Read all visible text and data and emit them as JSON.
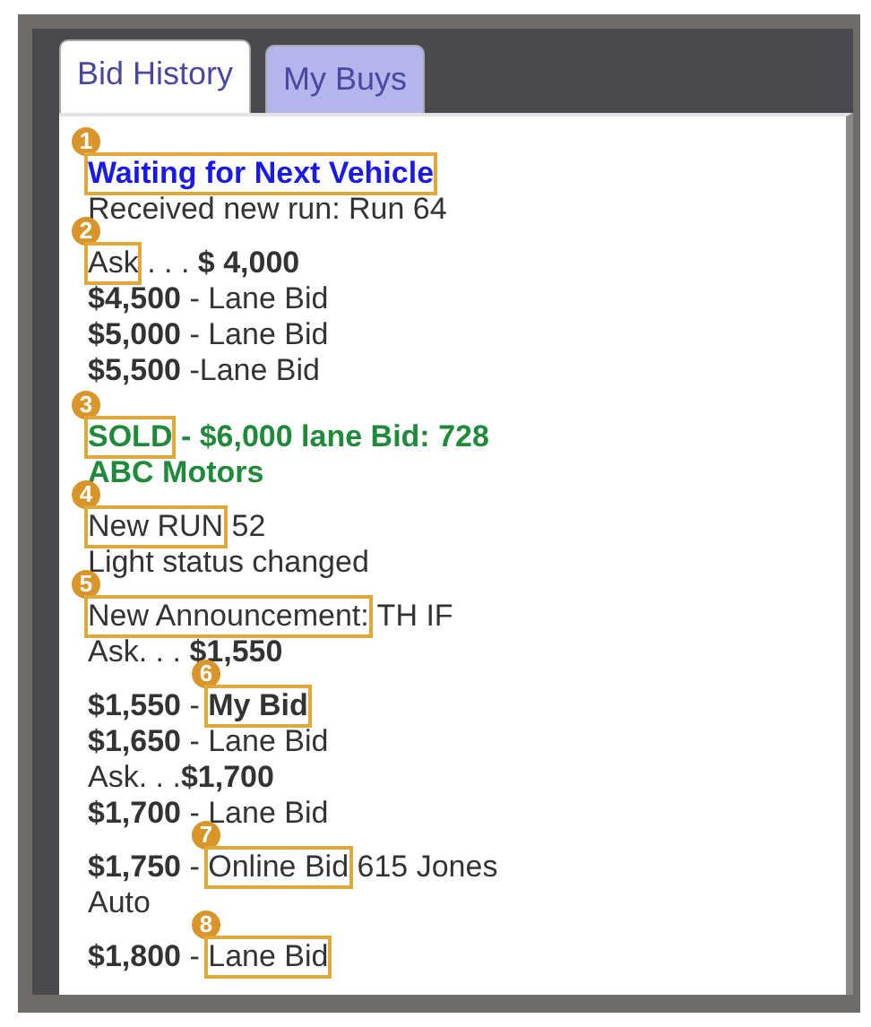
{
  "tabs": [
    {
      "label": "Bid History",
      "selected": true
    },
    {
      "label": "My Buys",
      "selected": false
    }
  ],
  "groups": [
    {
      "lines": [
        {
          "segments": [
            {
              "kind": "callout",
              "text": "1"
            },
            {
              "text": "Waiting for Next Vehicle",
              "kind": "link",
              "boxed": true
            }
          ]
        },
        {
          "segments": [
            {
              "text": "Received new run: Run 64",
              "kind": "plain"
            }
          ]
        },
        {
          "segments": [
            {
              "kind": "callout",
              "text": "2"
            },
            {
              "text": "Ask",
              "kind": "plain",
              "boxed": true
            },
            {
              "text": " . . . ",
              "kind": "plain"
            },
            {
              "text": "$ 4,000",
              "kind": "bold"
            }
          ]
        },
        {
          "segments": [
            {
              "text": "$4,500",
              "kind": "bold"
            },
            {
              "text": " - Lane Bid",
              "kind": "plain"
            }
          ]
        },
        {
          "segments": [
            {
              "text": "$5,000",
              "kind": "bold"
            },
            {
              "text": " - Lane Bid",
              "kind": "plain"
            }
          ]
        },
        {
          "segments": [
            {
              "text": "$5,500",
              "kind": "bold"
            },
            {
              "text": " -Lane Bid",
              "kind": "plain"
            }
          ]
        }
      ]
    },
    {
      "lines": [
        {
          "segments": [
            {
              "kind": "callout",
              "text": "3"
            },
            {
              "text": "SOLD",
              "kind": "sold",
              "boxed": true
            },
            {
              "text": " - $6,000 lane Bid: 728",
              "kind": "sold"
            }
          ]
        },
        {
          "segments": [
            {
              "text": "ABC Motors",
              "kind": "sold"
            }
          ]
        },
        {
          "segments": [
            {
              "kind": "callout",
              "text": "4"
            },
            {
              "text": "New RUN",
              "kind": "plain",
              "boxed": true
            },
            {
              "text": " 52",
              "kind": "plain"
            }
          ]
        },
        {
          "segments": [
            {
              "text": "Light status changed",
              "kind": "plain"
            }
          ]
        },
        {
          "segments": [
            {
              "kind": "callout",
              "text": "5"
            },
            {
              "text": "New Announcement:",
              "kind": "plain",
              "boxed": true
            },
            {
              "text": " TH IF",
              "kind": "plain"
            }
          ]
        },
        {
          "segments": [
            {
              "text": "Ask. . . ",
              "kind": "plain"
            },
            {
              "text": "$1,550",
              "kind": "bold"
            }
          ]
        },
        {
          "segments": [
            {
              "kind": "callout",
              "text": "6"
            },
            {
              "text": "$1,550",
              "kind": "bold"
            },
            {
              "text": " - ",
              "kind": "plain"
            },
            {
              "text": "My Bid",
              "kind": "bold",
              "boxed": true
            }
          ]
        },
        {
          "segments": [
            {
              "text": "$1,650",
              "kind": "bold"
            },
            {
              "text": " - Lane Bid",
              "kind": "plain"
            }
          ]
        },
        {
          "segments": [
            {
              "text": "Ask. . .",
              "kind": "plain"
            },
            {
              "text": "$1,700",
              "kind": "bold"
            }
          ]
        },
        {
          "segments": [
            {
              "text": "$1,700",
              "kind": "bold"
            },
            {
              "text": " - Lane Bid",
              "kind": "plain"
            }
          ]
        },
        {
          "segments": [
            {
              "kind": "callout",
              "text": "7"
            },
            {
              "text": "$1,750",
              "kind": "bold"
            },
            {
              "text": " - ",
              "kind": "plain"
            },
            {
              "text": "Online Bid",
              "kind": "plain",
              "boxed": true
            },
            {
              "text": " 615 Jones",
              "kind": "plain"
            }
          ]
        },
        {
          "segments": [
            {
              "text": "Auto",
              "kind": "plain"
            }
          ]
        },
        {
          "segments": [
            {
              "kind": "callout",
              "text": "8"
            },
            {
              "text": "$1,800",
              "kind": "bold"
            },
            {
              "text": " - ",
              "kind": "plain"
            },
            {
              "text": "Lane Bid",
              "kind": "plain",
              "boxed": true
            }
          ]
        }
      ]
    }
  ]
}
